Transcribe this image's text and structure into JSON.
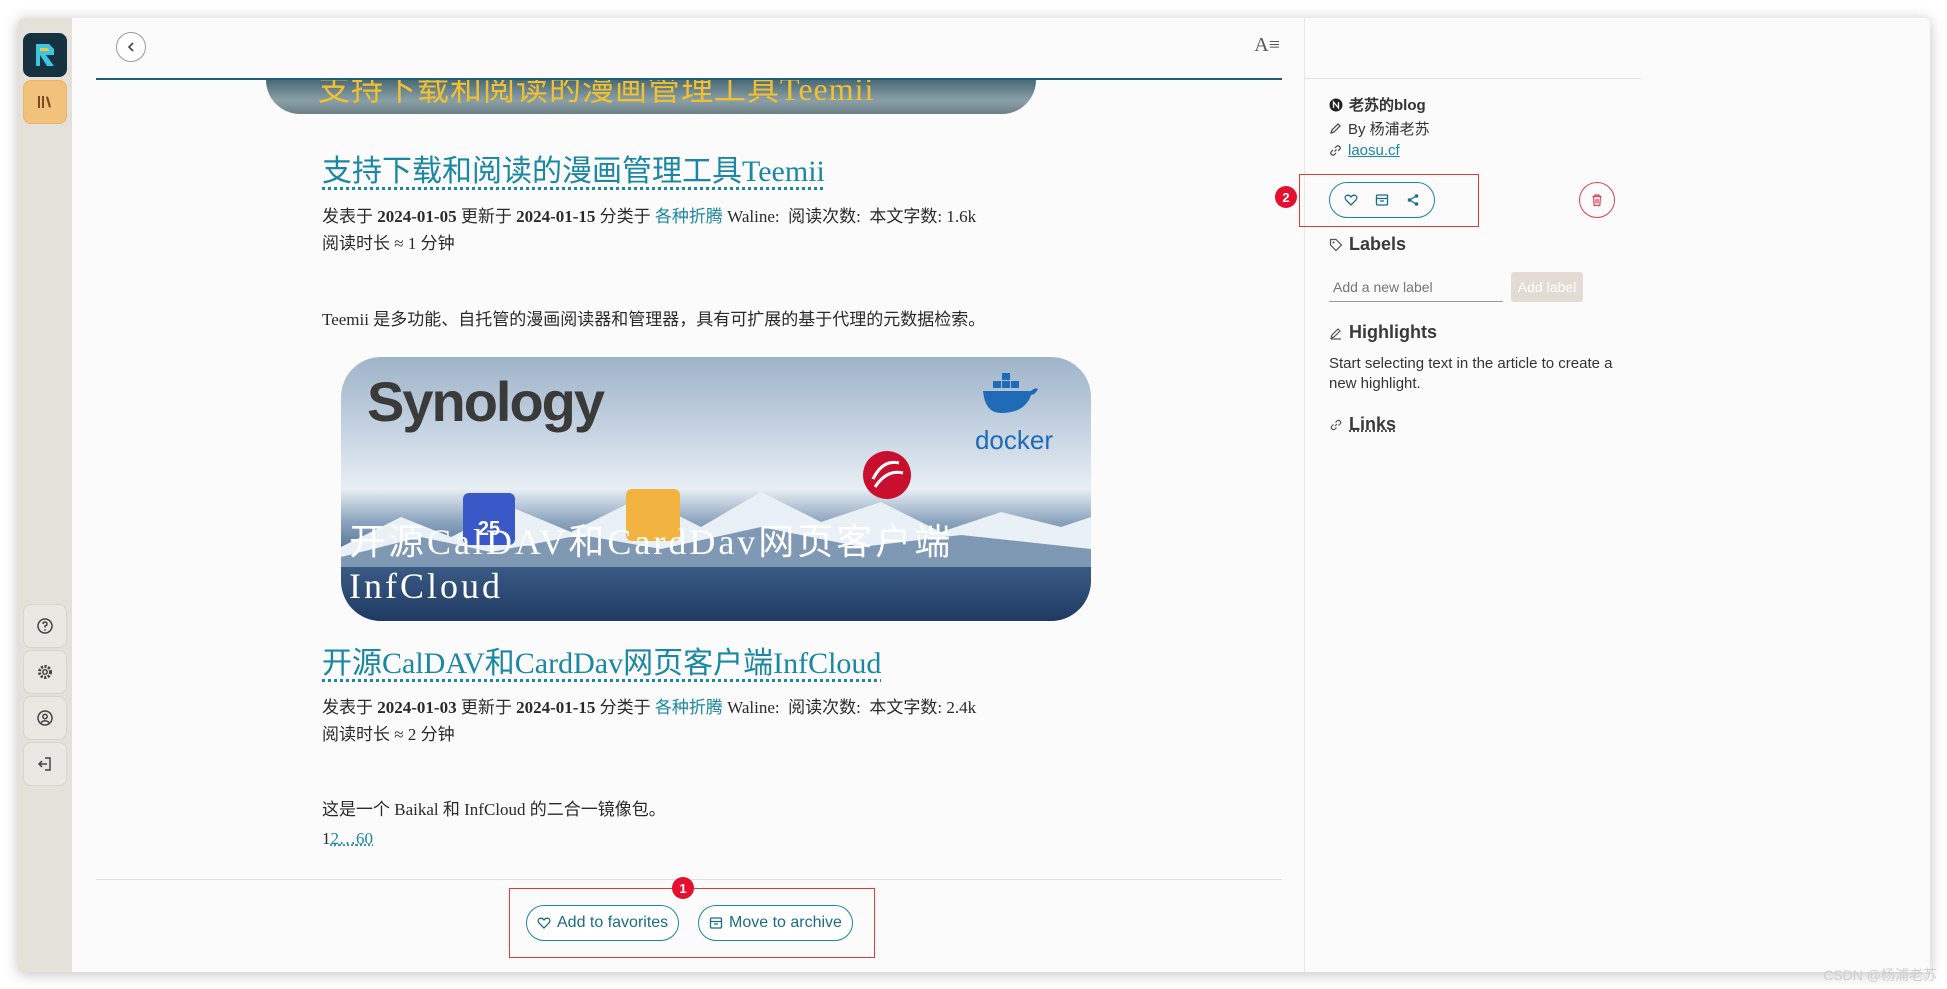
{
  "topbar": {
    "font_icon": "A≡"
  },
  "banner_text": "支持下载和阅读的漫画管理工具Teemii",
  "posts": [
    {
      "title": "支持下载和阅读的漫画管理工具Teemii",
      "meta_prefix": "发表于",
      "published": "2024-01-05",
      "updated_label": "更新于",
      "updated": "2024-01-15",
      "category_label": "分类于",
      "category": "各种折腾",
      "waline": "Waline:",
      "views_label": "阅读次数:",
      "words_label": "本文字数:",
      "words": "1.6k",
      "read_time": "阅读时长 ≈ 1 分钟",
      "excerpt": "Teemii 是多功能、自托管的漫画阅读器和管理器，具有可扩展的基于代理的元数据检索。"
    },
    {
      "title": "开源CalDAV和CardDav网页客户端InfCloud",
      "meta_prefix": "发表于",
      "published": "2024-01-03",
      "updated_label": "更新于",
      "updated": "2024-01-15",
      "category_label": "分类于",
      "category": "各种折腾",
      "waline": "Waline:",
      "views_label": "阅读次数:",
      "words_label": "本文字数:",
      "words": "2.4k",
      "read_time": "阅读时长 ≈ 2 分钟",
      "excerpt": "这是一个 Baikal 和 InfCloud 的二合一镜像包。"
    }
  ],
  "feature_image": {
    "brand": "Synology",
    "docker": "docker",
    "calendar_day": "25",
    "caption": "开源CalDAV和CardDav网页客户端InfCloud"
  },
  "pagination": {
    "current": "1",
    "page2": "2",
    "ellipsis": "…",
    "last": "60"
  },
  "bottom_actions": {
    "favorite": "Add to favorites",
    "archive": "Move to archive"
  },
  "annotations": {
    "one": "1",
    "two": "2"
  },
  "right_panel": {
    "site_name": "老苏的blog",
    "author": "By 杨浦老苏",
    "url": "laosu.cf",
    "labels_title": "Labels",
    "label_placeholder": "Add a new label",
    "add_label": "Add label",
    "highlights_title": "Highlights",
    "highlights_text": "Start selecting text in the article to create a new highlight.",
    "links_title": "Links"
  },
  "watermark": "CSDN @杨浦老苏",
  "colors": {
    "accent": "#1a87a3",
    "annotation": "#e5102f",
    "active_nav": "#f2c17c"
  }
}
